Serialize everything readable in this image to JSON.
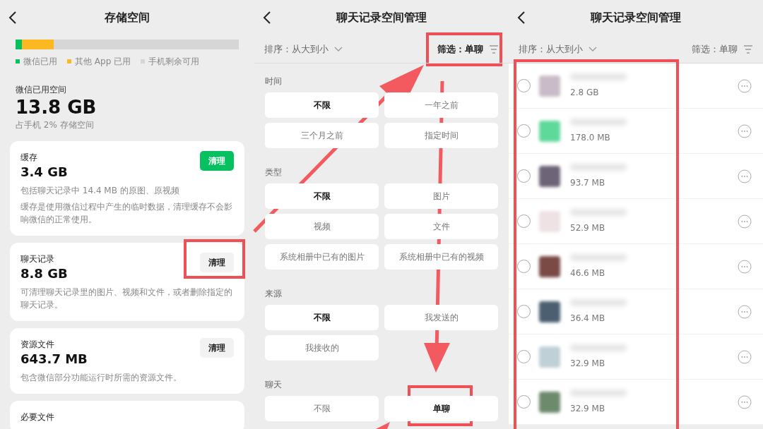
{
  "storage_screen": {
    "title": "存储空间",
    "usage_bar": [
      {
        "level": 0.03
      },
      {
        "level": 0.14
      }
    ],
    "legend": [
      {
        "label": "微信已用",
        "color": "#07c160"
      },
      {
        "label": "其他 App 已用",
        "color": "#fbb820"
      },
      {
        "label": "手机剩余可用",
        "color": "#d6d6d6"
      }
    ],
    "used_label": "微信已用空间",
    "used_value": "13.8 GB",
    "used_note": "占手机 2% 存储空间",
    "cards": [
      {
        "title": "缓存",
        "size": "3.4 GB",
        "button": "清理",
        "primary": true,
        "notes": [
          "包括聊天记录中 14.4 MB 的原图、原视频",
          "缓存是使用微信过程中产生的临时数据，清理缓存不会影响微信的正常使用。"
        ]
      },
      {
        "title": "聊天记录",
        "size": "8.8 GB",
        "button": "清理",
        "primary": false,
        "notes": [
          "可清理聊天记录里的图片、视频和文件，或者删除指定的聊天记录。"
        ]
      },
      {
        "title": "资源文件",
        "size": "643.7 MB",
        "button": "清理",
        "primary": false,
        "notes": [
          "包含微信部分功能运行时所需的资源文件。"
        ]
      },
      {
        "title": "必要文件"
      }
    ]
  },
  "filter_screen": {
    "title": "聊天记录空间管理",
    "sort": "排序：从大到小",
    "filter": "筛选：单聊",
    "sections": [
      {
        "title": "时间",
        "options": [
          {
            "label": "不限",
            "selected": true
          },
          {
            "label": "一年之前",
            "selected": false
          },
          {
            "label": "三个月之前",
            "selected": false
          },
          {
            "label": "指定时间",
            "selected": false
          }
        ]
      },
      {
        "title": "类型",
        "options": [
          {
            "label": "不限",
            "selected": true
          },
          {
            "label": "图片",
            "selected": false
          },
          {
            "label": "视频",
            "selected": false
          },
          {
            "label": "文件",
            "selected": false
          },
          {
            "label": "系统相册中已有的图片",
            "selected": false
          },
          {
            "label": "系统相册中已有的视频",
            "selected": false
          }
        ]
      },
      {
        "title": "来源",
        "options": [
          {
            "label": "不限",
            "selected": true
          },
          {
            "label": "我发送的",
            "selected": false
          },
          {
            "label": "我接收的",
            "selected": false
          }
        ]
      },
      {
        "title": "聊天",
        "options": [
          {
            "label": "不限",
            "selected": false
          },
          {
            "label": "单聊",
            "selected": true
          }
        ]
      }
    ]
  },
  "list_screen": {
    "title": "聊天记录空间管理",
    "sort": "排序：从大到小",
    "filter": "筛选：单聊",
    "chats": [
      {
        "size": "2.8 GB",
        "color": "#c9bcc8",
        "selected": false
      },
      {
        "size": "178.0 MB",
        "color": "#5fd99a",
        "selected": false
      },
      {
        "size": "93.7 MB",
        "color": "#6e6478",
        "selected": false
      },
      {
        "size": "52.9 MB",
        "color": "#eee2e4",
        "selected": false
      },
      {
        "size": "46.6 MB",
        "color": "#7a4a45",
        "selected": false
      },
      {
        "size": "36.4 MB",
        "color": "#4b5f70",
        "selected": false
      },
      {
        "size": "32.9 MB",
        "color": "#bfd0d6",
        "selected": false
      },
      {
        "size": "32.9 MB",
        "color": "#6e8a6c",
        "selected": false
      }
    ]
  }
}
